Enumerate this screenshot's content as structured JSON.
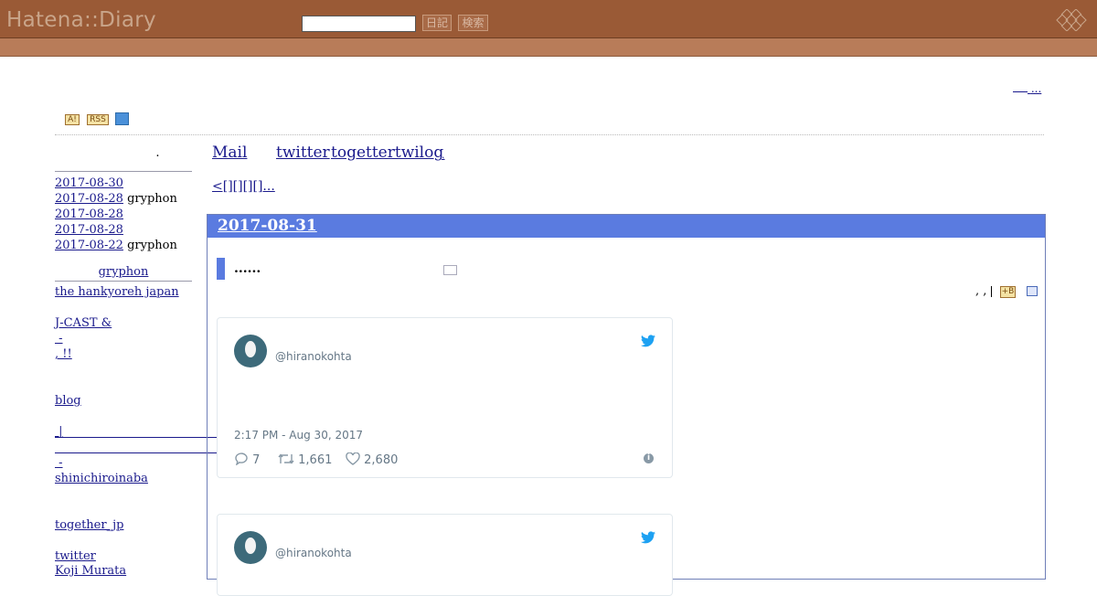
{
  "header": {
    "logo": "Hatena::Diary",
    "search_value": "",
    "diary_button": "日記",
    "search_button": "検索"
  },
  "top_right_link": "...",
  "badges": {
    "a": "A!",
    "rss": "RSS"
  },
  "sidebar": {
    "title": ".",
    "recent": [
      {
        "date": "2017-08-30",
        "extra": ""
      },
      {
        "date": "2017-08-28",
        "extra": " gryphon"
      },
      {
        "date": "2017-08-28",
        "extra": ""
      },
      {
        "date": "2017-08-28",
        "extra": ""
      },
      {
        "date": "2017-08-22",
        "extra": " gryphon"
      }
    ],
    "links_title": "gryphon",
    "links": [
      "the hankyoreh japan",
      "J-CAST &",
      " -",
      ", !!",
      "blog",
      " |",
      " -",
      "shinichiroinaba",
      "together_jp",
      "twitter",
      "Koji Murata"
    ]
  },
  "nav": {
    "mail": "Mail",
    "twitter": "twitter",
    "togetter": "togettertwilog",
    "dot": ".",
    "crumb": "<[][][][]..."
  },
  "day": {
    "date": "2017-08-31",
    "section_title": "......",
    "meta": ", ,",
    "hatena_bookmark": "+B"
  },
  "tweets": [
    {
      "handle": "@hiranokohta",
      "time": "2:17 PM - Aug 30, 2017",
      "replies": "7",
      "retweets": "1,661",
      "likes": "2,680"
    },
    {
      "handle": "@hiranokohta"
    }
  ]
}
